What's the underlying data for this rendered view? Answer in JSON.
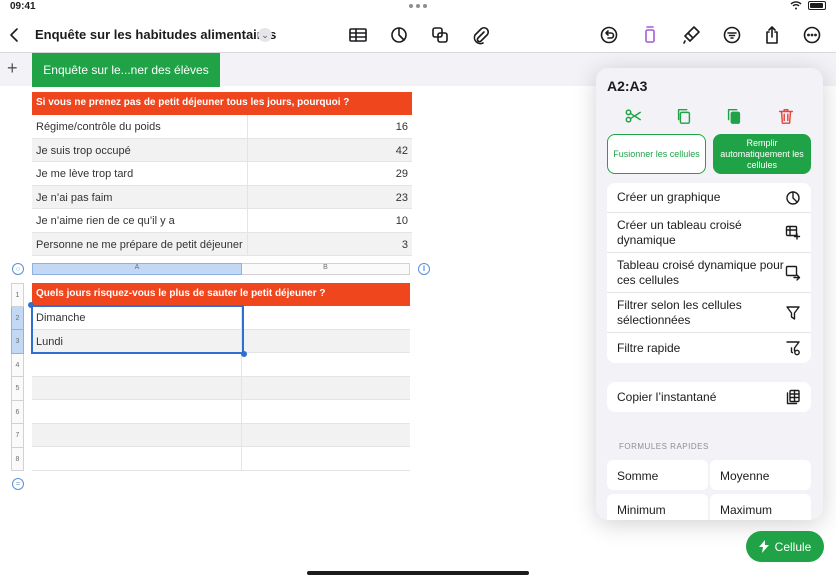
{
  "status_bar": {
    "time": "09:41"
  },
  "toolbar": {
    "document_title": "Enquête sur les habitudes alimentaires",
    "icons": [
      "back-icon",
      "table-icon",
      "chart-icon",
      "shapes-icon",
      "attachment-icon",
      "undo-icon",
      "format-icon",
      "paintbrush-icon",
      "sort-filter-icon",
      "share-icon",
      "more-icon"
    ]
  },
  "sheet_tab": {
    "label": "Enquête sur le...ner des élèves"
  },
  "table1": {
    "header": "Si vous ne prenez pas de petit déjeuner tous les jours, pourquoi ?",
    "rows": [
      {
        "reason": "Régime/contrôle du poids",
        "count": "16"
      },
      {
        "reason": "Je suis trop occupé",
        "count": "42"
      },
      {
        "reason": "Je me lève trop tard",
        "count": "29"
      },
      {
        "reason": "Je n’ai pas faim",
        "count": "23"
      },
      {
        "reason": "Je n’aime rien de ce qu’il y a",
        "count": "10"
      },
      {
        "reason": "Personne ne me prépare de petit déjeuner",
        "count": "3"
      }
    ]
  },
  "table2": {
    "column_headers": [
      "A",
      "B"
    ],
    "row_numbers": [
      "1",
      "2",
      "3",
      "4",
      "5",
      "6",
      "7",
      "8"
    ],
    "header": "Quels jours risquez-vous le plus de sauter le petit déjeuner ?",
    "rows": [
      "Dimanche",
      "Lundi",
      "",
      "",
      "",
      "",
      ""
    ]
  },
  "popover": {
    "selection_ref": "A2:A3",
    "merge_button": "Fusionner les cellules",
    "autofill_button": "Remplir automatiquement les cellules",
    "menu_items": [
      {
        "label": "Créer un graphique",
        "icon": "chart-icon"
      },
      {
        "label": "Créer un tableau croisé dynamique",
        "icon": "pivot-table-icon"
      },
      {
        "label": "Tableau croisé dynamique pour ces cellules",
        "icon": "pivot-cells-icon"
      },
      {
        "label": "Filtrer selon les cellules sélectionnées",
        "icon": "filter-icon"
      },
      {
        "label": "Filtre rapide",
        "icon": "quick-filter-icon"
      }
    ],
    "snapshot_item": {
      "label": "Copier l’instantané",
      "icon": "snapshot-icon"
    },
    "quick_formulas_label": "FORMULES RAPIDES",
    "quick_formulas": [
      "Somme",
      "Moyenne",
      "Minimum",
      "Maximum"
    ]
  },
  "cell_button": {
    "label": "Cellule"
  },
  "colors": {
    "accent_green": "#1fa346",
    "header_orange": "#f0461e",
    "selection_blue": "#2f6fd2"
  }
}
